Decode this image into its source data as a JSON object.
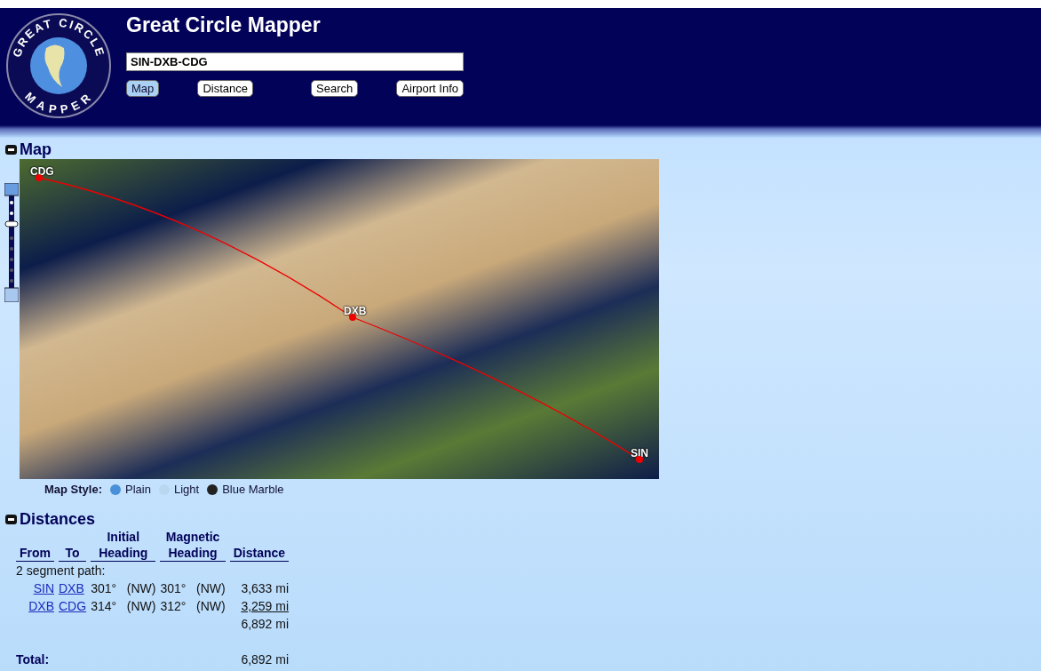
{
  "logo": {
    "top_text": "GREAT CIRCLE",
    "bottom_text": "MAPPER"
  },
  "header": {
    "title": "Great Circle Mapper",
    "route_field": {
      "value": "SIN-DXB-CDG"
    },
    "nav": [
      {
        "label": "Map",
        "selected": true
      },
      {
        "label": "Distance",
        "selected": false
      },
      {
        "label": "Search",
        "selected": false
      },
      {
        "label": "Airport Info",
        "selected": false
      }
    ]
  },
  "map_section": {
    "heading": "Map",
    "airports": [
      "CDG",
      "DXB",
      "SIN"
    ],
    "style_label": "Map Style:",
    "styles": [
      {
        "label": "Plain",
        "kind": "plain"
      },
      {
        "label": "Light",
        "kind": "light"
      },
      {
        "label": "Blue Marble",
        "kind": "marble"
      }
    ]
  },
  "distances": {
    "heading": "Distances",
    "columns": [
      "From",
      "To",
      "Initial\nHeading",
      "Magnetic\nHeading",
      "Distance"
    ],
    "path_label": "2 segment path:",
    "segments": [
      {
        "from": "SIN",
        "to": "DXB",
        "initial": "301°",
        "initial_dir": "(NW)",
        "magnetic": "301°",
        "magnetic_dir": "(NW)",
        "distance": "3,633 mi"
      },
      {
        "from": "DXB",
        "to": "CDG",
        "initial": "314°",
        "initial_dir": "(NW)",
        "magnetic": "312°",
        "magnetic_dir": "(NW)",
        "distance": "3,259 mi"
      }
    ],
    "subtotal": "6,892 mi",
    "total_label": "Total:",
    "total": "6,892 mi"
  }
}
